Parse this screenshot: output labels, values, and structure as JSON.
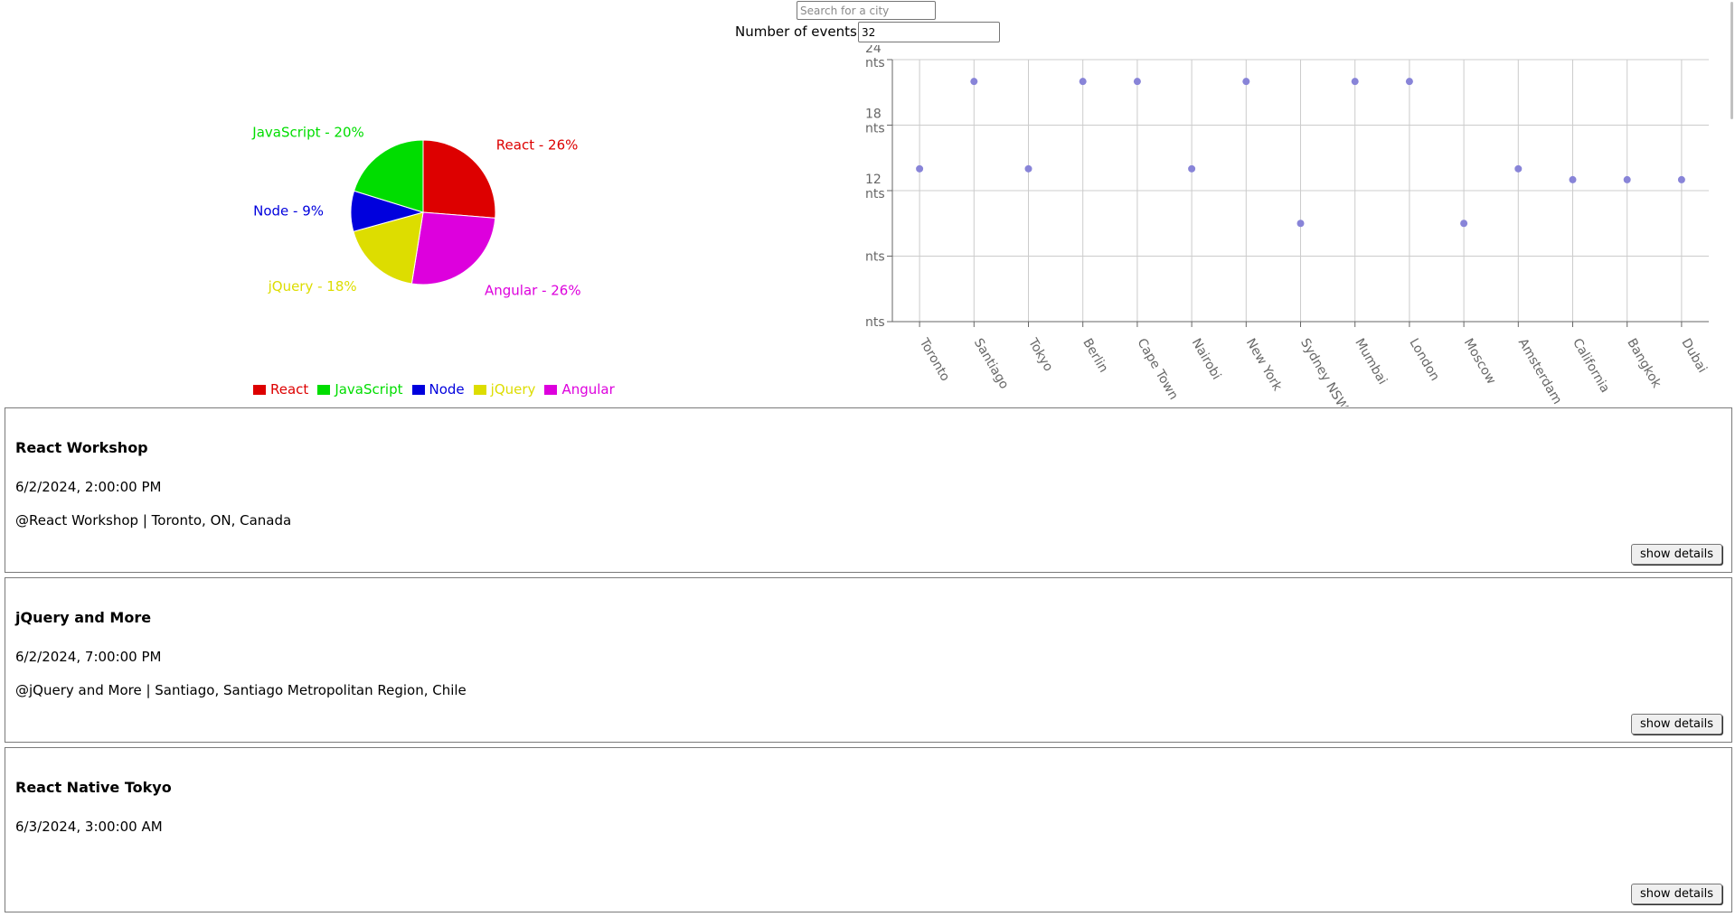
{
  "search": {
    "placeholder": "Search for a city",
    "value": ""
  },
  "events_count": {
    "label": "Number of events:",
    "value": "32"
  },
  "colors": {
    "React": "#dd0000",
    "JavaScript": "#00dd00",
    "Node": "#0000dd",
    "jQuery": "#dddd00",
    "Angular": "#dd00dd",
    "scatter_point": "#8884d8",
    "grid": "#cccccc",
    "axis": "#666666"
  },
  "chart_data": [
    {
      "type": "pie",
      "slices": [
        {
          "name": "React",
          "value": 26,
          "label": "React - 26%"
        },
        {
          "name": "Angular",
          "value": 26,
          "label": "Angular - 26%"
        },
        {
          "name": "jQuery",
          "value": 18,
          "label": "jQuery - 18%"
        },
        {
          "name": "Node",
          "value": 9,
          "label": "Node - 9%"
        },
        {
          "name": "JavaScript",
          "value": 20,
          "label": "JavaScript - 20%"
        }
      ],
      "legend": [
        "React",
        "JavaScript",
        "Node",
        "jQuery",
        "Angular"
      ],
      "legend_placement": "bottom"
    },
    {
      "type": "scatter",
      "categories": [
        "Toronto",
        "Santiago",
        "Tokyo",
        "Berlin",
        "Cape Town",
        "Nairobi",
        "New York",
        "Sydney NSW",
        "Mumbai",
        "London",
        "Moscow",
        "Amsterdam",
        "California",
        "Bangkok",
        "Dubai"
      ],
      "values": [
        14,
        22,
        14,
        22,
        22,
        14,
        22,
        9,
        22,
        22,
        9,
        14,
        13,
        13,
        13
      ],
      "ylim": [
        0,
        24
      ],
      "yticks": [
        0,
        6,
        12,
        18,
        24
      ],
      "ytick_labels": [
        "nts",
        "nts",
        "12\nnts",
        "18\nnts",
        "24\nnts"
      ],
      "grid": true
    }
  ],
  "events": [
    {
      "title": "React Workshop",
      "date": "6/2/2024, 2:00:00 PM",
      "location": "@React Workshop | Toronto, ON, Canada",
      "button": "show details"
    },
    {
      "title": "jQuery and More",
      "date": "6/2/2024, 7:00:00 PM",
      "location": "@jQuery and More | Santiago, Santiago Metropolitan Region, Chile",
      "button": "show details"
    },
    {
      "title": "React Native Tokyo",
      "date": "6/3/2024, 3:00:00 AM",
      "location": "",
      "button": "show details"
    }
  ]
}
